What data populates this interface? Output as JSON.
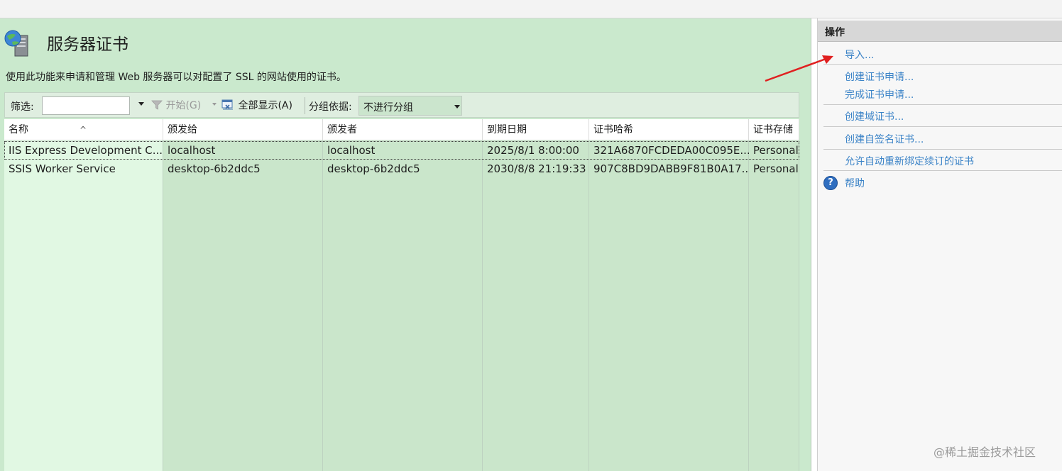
{
  "header": {
    "title": "服务器证书",
    "description": "使用此功能来申请和管理 Web 服务器可以对配置了 SSL 的网站使用的证书。"
  },
  "toolbar": {
    "filter_label": "筛选:",
    "filter_value": "",
    "start_label": "开始(G)",
    "show_all_label": "全部显示(A)",
    "groupby_label": "分组依据:",
    "groupby_value": "不进行分组"
  },
  "table": {
    "columns": [
      "名称",
      "颁发给",
      "颁发者",
      "到期日期",
      "证书哈希",
      "证书存储"
    ],
    "rows": [
      [
        "IIS Express Development C...",
        "localhost",
        "localhost",
        "2025/8/1 8:00:00",
        "321A6870FCDEDA00C095E...",
        "Personal"
      ],
      [
        "SSIS Worker Service",
        "desktop-6b2ddc5",
        "desktop-6b2ddc5",
        "2030/8/8 21:19:33",
        "907C8BD9DABB9F81B0A17...",
        "Personal"
      ]
    ],
    "selected_row": 0
  },
  "actions": {
    "title": "操作",
    "import": "导入...",
    "create_request": "创建证书申请...",
    "complete_request": "完成证书申请...",
    "create_domain": "创建域证书...",
    "create_self_signed": "创建自签名证书...",
    "allow_rebind": "允许自动重新绑定续订的证书",
    "help": "帮助"
  },
  "watermark": "@稀土掘金技术社区",
  "colors": {
    "main_bg": "#cae9cd",
    "first_column_bg": "#e1f8e3",
    "link": "#3b83c7",
    "annotation_arrow": "#e02020"
  },
  "icons": {
    "header": "server-certificate-icon",
    "start": "funnel-icon",
    "show_all": "show-all-icon",
    "help": "help-icon"
  }
}
